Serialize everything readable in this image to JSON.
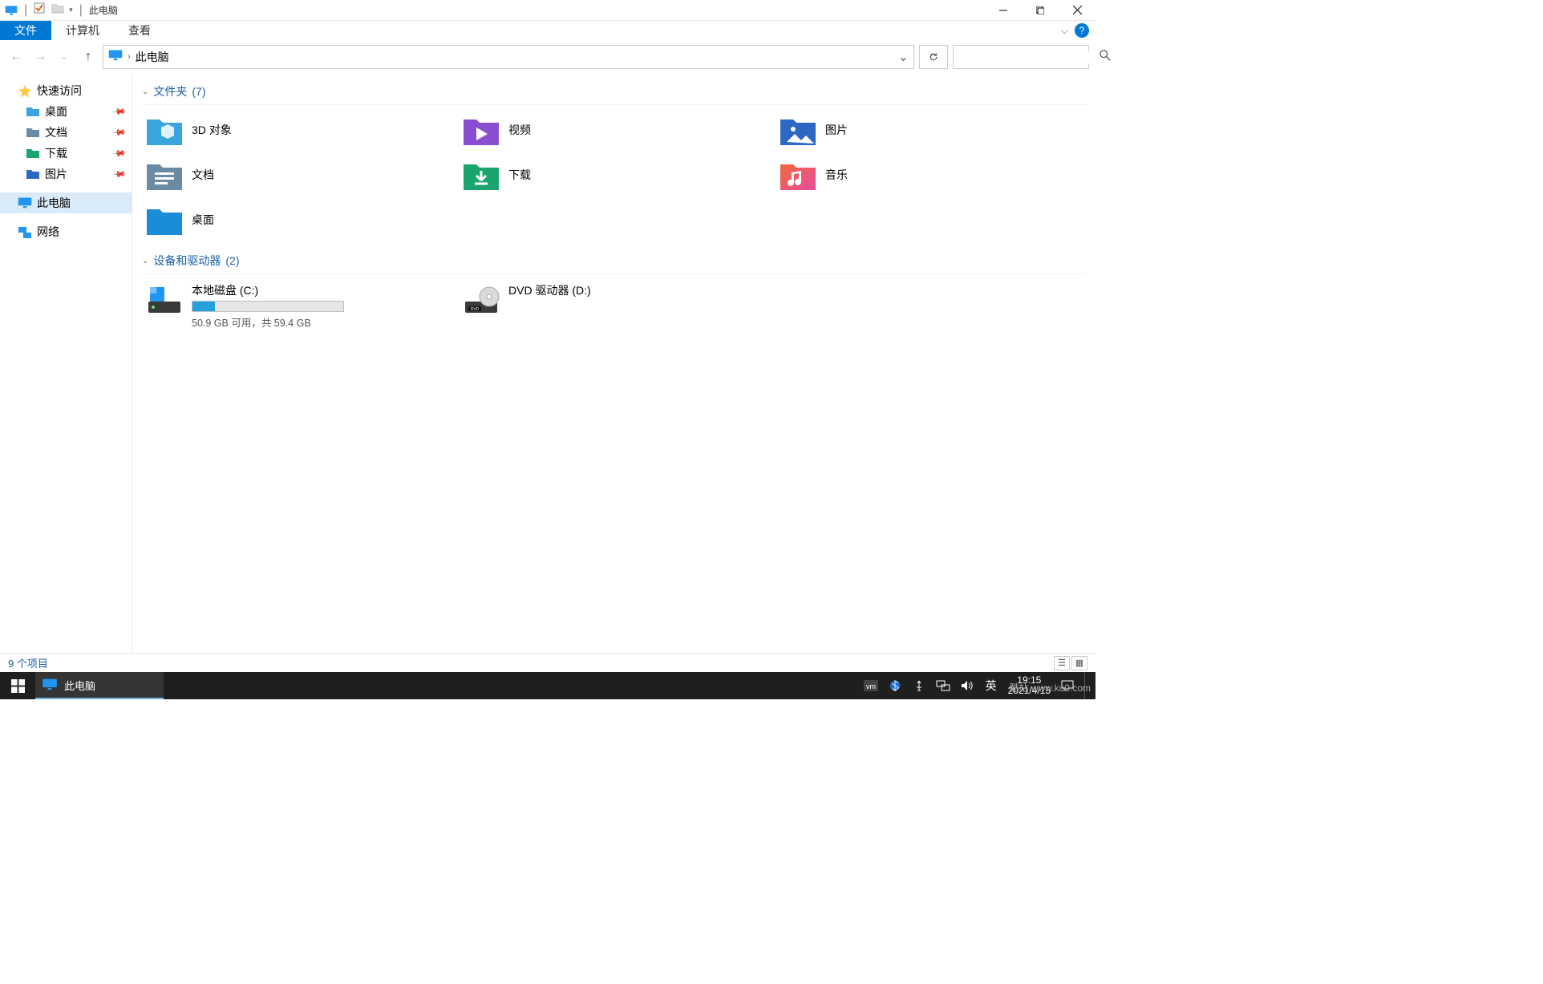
{
  "window": {
    "title": "此电脑"
  },
  "ribbon": {
    "file": "文件",
    "tabs": [
      "计算机",
      "查看"
    ],
    "help_tooltip": "?"
  },
  "breadcrumb": {
    "location": "此电脑"
  },
  "search": {
    "placeholder": ""
  },
  "sidebar": {
    "quick_access": "快速访问",
    "quick_items": [
      {
        "label": "桌面"
      },
      {
        "label": "文档"
      },
      {
        "label": "下载"
      },
      {
        "label": "图片"
      }
    ],
    "this_pc": "此电脑",
    "network": "网络"
  },
  "sections": {
    "folders": {
      "title": "文件夹",
      "count": "(7)"
    },
    "drives": {
      "title": "设备和驱动器",
      "count": "(2)"
    }
  },
  "folders": [
    {
      "label": "3D 对象"
    },
    {
      "label": "视频"
    },
    {
      "label": "图片"
    },
    {
      "label": "文档"
    },
    {
      "label": "下载"
    },
    {
      "label": "音乐"
    },
    {
      "label": "桌面"
    }
  ],
  "drives": [
    {
      "label": "本地磁盘 (C:)",
      "sub": "50.9 GB 可用，共 59.4 GB",
      "fill_pct": 15
    },
    {
      "label": "DVD 驱动器 (D:)"
    }
  ],
  "status": {
    "items": "9 个项目"
  },
  "taskbar": {
    "active": "此电脑",
    "ime": "英",
    "time": "19:15",
    "date": "2021/4/15"
  },
  "watermark": "酷站 www.ku0.com"
}
